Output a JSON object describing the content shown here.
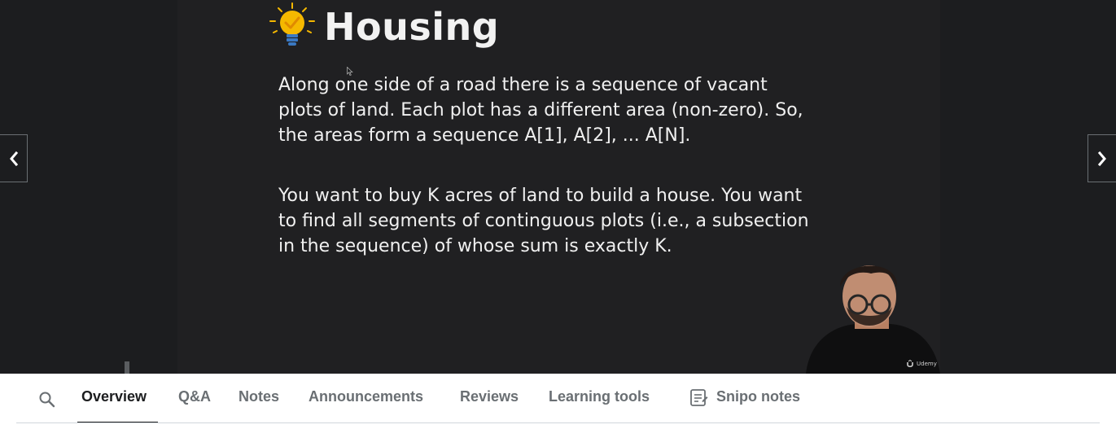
{
  "slide": {
    "title": "Housing",
    "paragraphs": [
      "Along one side of a road there is a sequence of vacant plots of land. Each plot has a different area (non-zero). So, the areas form a sequence A[1], A[2], ... A[N].",
      "You want to buy K acres of land to build a house. You want to find all segments of continguous plots (i.e., a subsection in the sequence) of whose sum is exactly K."
    ],
    "title_icon": "lightbulb-check-icon"
  },
  "player": {
    "prev_icon": "chevron-left-icon",
    "next_icon": "chevron-right-icon",
    "watermark": "Udemy"
  },
  "tabs": {
    "search_icon": "search-icon",
    "items": [
      {
        "label": "Overview",
        "active": true
      },
      {
        "label": "Q&A"
      },
      {
        "label": "Notes"
      },
      {
        "label": "Announcements"
      },
      {
        "label": "Reviews"
      },
      {
        "label": "Learning tools"
      },
      {
        "label": "Snipo notes",
        "icon": "notes-list-icon"
      }
    ]
  },
  "colors": {
    "video_bg": "#1c1d1f",
    "slide_bg": "#202022",
    "bulb": "#f5b800",
    "tab_active": "#1c1d1f",
    "tab_inactive": "#6a6f73"
  }
}
